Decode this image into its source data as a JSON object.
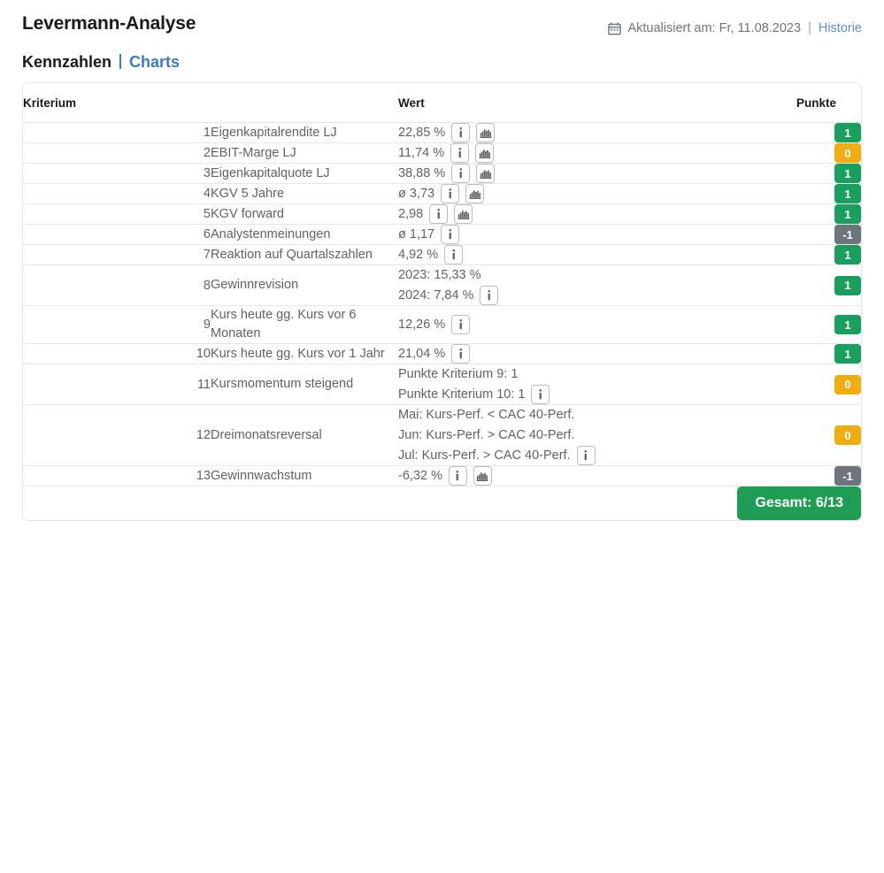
{
  "header": {
    "title": "Levermann-Analyse",
    "calendar_icon": "calendar-icon",
    "updated_label": "Aktualisiert am: Fr, 11.08.2023",
    "separator": "|",
    "history_link": "Historie"
  },
  "tabs": {
    "active_label": "Kennzahlen",
    "divider": "|",
    "link_label": "Charts"
  },
  "table": {
    "columns": {
      "criterion": "Kriterium",
      "value": "Wert",
      "points": "Punkte"
    },
    "rows": [
      {
        "num": "1",
        "label": "Eigenkapitalrendite LJ",
        "value_lines": [
          "22,85 %"
        ],
        "icons": [
          "info-icon",
          "chart-icon"
        ],
        "icons_on_line": 0,
        "points": "1",
        "points_color": "green"
      },
      {
        "num": "2",
        "label": "EBIT-Marge LJ",
        "value_lines": [
          "11,74 %"
        ],
        "icons": [
          "info-icon",
          "chart-icon"
        ],
        "icons_on_line": 0,
        "points": "0",
        "points_color": "orange"
      },
      {
        "num": "3",
        "label": "Eigenkapitalquote LJ",
        "value_lines": [
          "38,88 %"
        ],
        "icons": [
          "info-icon",
          "chart-icon"
        ],
        "icons_on_line": 0,
        "points": "1",
        "points_color": "green"
      },
      {
        "num": "4",
        "label": "KGV 5 Jahre",
        "value_lines": [
          "ø 3,73"
        ],
        "icons": [
          "info-icon",
          "chart-icon"
        ],
        "icons_on_line": 0,
        "points": "1",
        "points_color": "green"
      },
      {
        "num": "5",
        "label": "KGV forward",
        "value_lines": [
          "2,98"
        ],
        "icons": [
          "info-icon",
          "chart-icon"
        ],
        "icons_on_line": 0,
        "points": "1",
        "points_color": "green"
      },
      {
        "num": "6",
        "label": "Analystenmeinungen",
        "value_lines": [
          "ø 1,17"
        ],
        "icons": [
          "info-icon"
        ],
        "icons_on_line": 0,
        "points": "-1",
        "points_color": "gray"
      },
      {
        "num": "7",
        "label": "Reaktion auf Quartalszahlen",
        "value_lines": [
          "4,92 %"
        ],
        "icons": [
          "info-icon"
        ],
        "icons_on_line": 0,
        "points": "1",
        "points_color": "green"
      },
      {
        "num": "8",
        "label": "Gewinnrevision",
        "value_lines": [
          "2023: 15,33 %",
          "2024: 7,84 %"
        ],
        "icons": [
          "info-icon"
        ],
        "icons_on_line": 1,
        "points": "1",
        "points_color": "green"
      },
      {
        "num": "9",
        "label": "Kurs heute gg. Kurs vor 6 Monaten",
        "value_lines": [
          "12,26 %"
        ],
        "icons": [
          "info-icon"
        ],
        "icons_on_line": 0,
        "points": "1",
        "points_color": "green"
      },
      {
        "num": "10",
        "label": "Kurs heute gg. Kurs vor 1 Jahr",
        "value_lines": [
          "21,04 %"
        ],
        "icons": [
          "info-icon"
        ],
        "icons_on_line": 0,
        "points": "1",
        "points_color": "green"
      },
      {
        "num": "11",
        "label": "Kursmomentum steigend",
        "value_lines": [
          "Punkte Kriterium 9: 1",
          "Punkte Kriterium 10: 1"
        ],
        "icons": [
          "info-icon"
        ],
        "icons_on_line": 1,
        "points": "0",
        "points_color": "orange"
      },
      {
        "num": "12",
        "label": "Dreimonatsreversal",
        "value_lines": [
          "Mai: Kurs-Perf. < CAC 40-Perf.",
          "Jun: Kurs-Perf. > CAC 40-Perf.",
          "Jul: Kurs-Perf. > CAC 40-Perf."
        ],
        "icons": [
          "info-icon"
        ],
        "icons_on_line": 2,
        "points": "0",
        "points_color": "orange"
      },
      {
        "num": "13",
        "label": "Gewinnwachstum",
        "value_lines": [
          "-6,32 %"
        ],
        "icons": [
          "info-icon",
          "chart-icon"
        ],
        "icons_on_line": 0,
        "points": "-1",
        "points_color": "gray"
      }
    ],
    "total_label": "Gesamt: 6/13"
  },
  "colors": {
    "green": "#1a9e5d",
    "orange": "#f0ac10",
    "gray": "#6c757d",
    "total_green": "#1f9d55",
    "link_blue": "#3c7bbf",
    "text_muted": "#5e6366"
  }
}
